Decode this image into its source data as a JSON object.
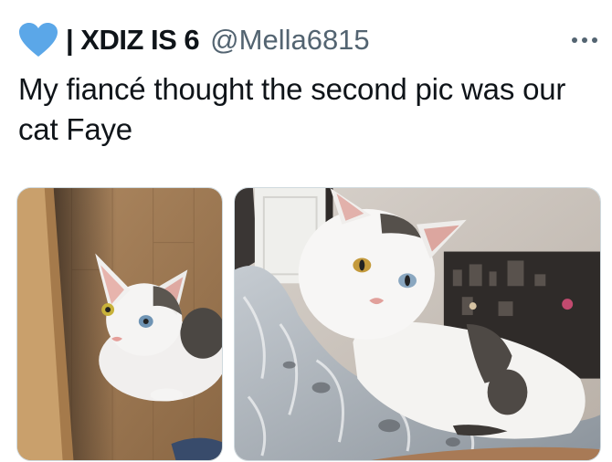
{
  "tweet": {
    "display_name": "| XDIZ IS 6",
    "handle": "@Mella6815",
    "text": "My fiancé thought the second pic was our cat Faye",
    "heart_color": "#5ba7e8"
  },
  "icons": {
    "profile_badge": "heart-icon",
    "more": "more-options-icon"
  },
  "media": [
    {
      "name": "photo-cat-on-floor",
      "subject": "white and grey cat with heterochromatic eyes on wooden floor"
    },
    {
      "name": "photo-cat-on-blanket",
      "subject": "white and grey cat with heterochromatic eyes lying on a fluffy blanket"
    }
  ]
}
